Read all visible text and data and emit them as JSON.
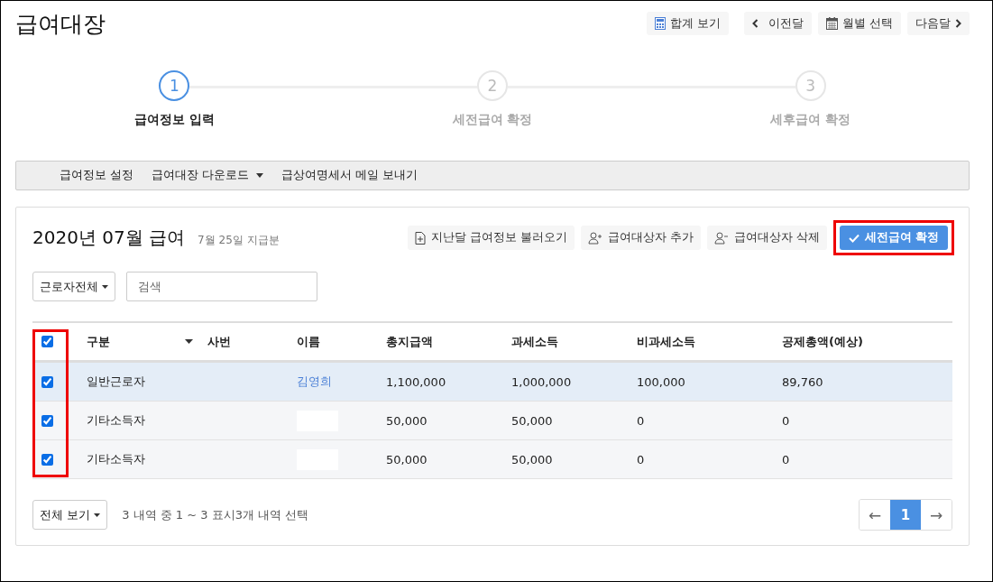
{
  "page_title": "급여대장",
  "top_buttons": [
    {
      "kind": "calculator",
      "label": "합계 보기"
    },
    {
      "kind": "prev",
      "label": "이전달"
    },
    {
      "kind": "calendar",
      "label": "월별 선택"
    },
    {
      "kind": "next",
      "label": "다음달"
    }
  ],
  "steps": [
    {
      "number": "1",
      "label": "급여정보 입력",
      "selected": true
    },
    {
      "number": "2",
      "label": "세전급여 확정",
      "selected": false
    },
    {
      "number": "3",
      "label": "세후급여 확정",
      "selected": false
    }
  ],
  "toolbar": [
    {
      "label": "급여정보 설정",
      "dropdown": false
    },
    {
      "label": "급여대장 다운로드",
      "dropdown": true
    },
    {
      "label": "급상여명세서 메일 보내기",
      "dropdown": false
    }
  ],
  "card": {
    "title": "2020년 07월 급여",
    "subtitle": "7월 25일 지급분",
    "actions": [
      {
        "kind": "import",
        "label": "지난달 급여정보 불러오기",
        "highlighted": false
      },
      {
        "kind": "add-person",
        "label": "급여대상자 추가",
        "highlighted": false
      },
      {
        "kind": "remove-person",
        "label": "급여대상자 삭제",
        "highlighted": false
      },
      {
        "kind": "confirm",
        "label": "세전급여 확정",
        "highlighted": true
      }
    ],
    "filter": {
      "label": "근로자전체"
    },
    "search": {
      "placeholder": "검색"
    }
  },
  "table": {
    "select_all_checked": true,
    "checkbox_column_highlighted": true,
    "columns": [
      "구분",
      "사번",
      "이름",
      "총지급액",
      "과세소득",
      "비과세소득",
      "공제총액(예상)"
    ],
    "rows": [
      {
        "checked": true,
        "hovered": true,
        "type": "일반근로자",
        "name": "김영희",
        "redacted": false,
        "total": "1,100,000",
        "taxable": "1,000,000",
        "nontaxable": "100,000",
        "deduction": "89,760"
      },
      {
        "checked": true,
        "hovered": false,
        "type": "기타소득자",
        "redacted": true,
        "total": "50,000",
        "taxable": "50,000",
        "nontaxable": "0",
        "deduction": "0"
      },
      {
        "checked": true,
        "hovered": false,
        "type": "기타소득자",
        "redacted": true,
        "total": "50,000",
        "taxable": "50,000",
        "nontaxable": "0",
        "deduction": "0"
      }
    ]
  },
  "footer": {
    "view": "전체 보기",
    "summary": "3 내역 중 1 ~ 3 표시3개 내역 선택",
    "pages": [
      {
        "label": "←",
        "kind": "prev",
        "selected": false
      },
      {
        "label": "1",
        "kind": "page",
        "selected": true
      },
      {
        "label": "→",
        "kind": "next",
        "selected": false
      }
    ]
  }
}
